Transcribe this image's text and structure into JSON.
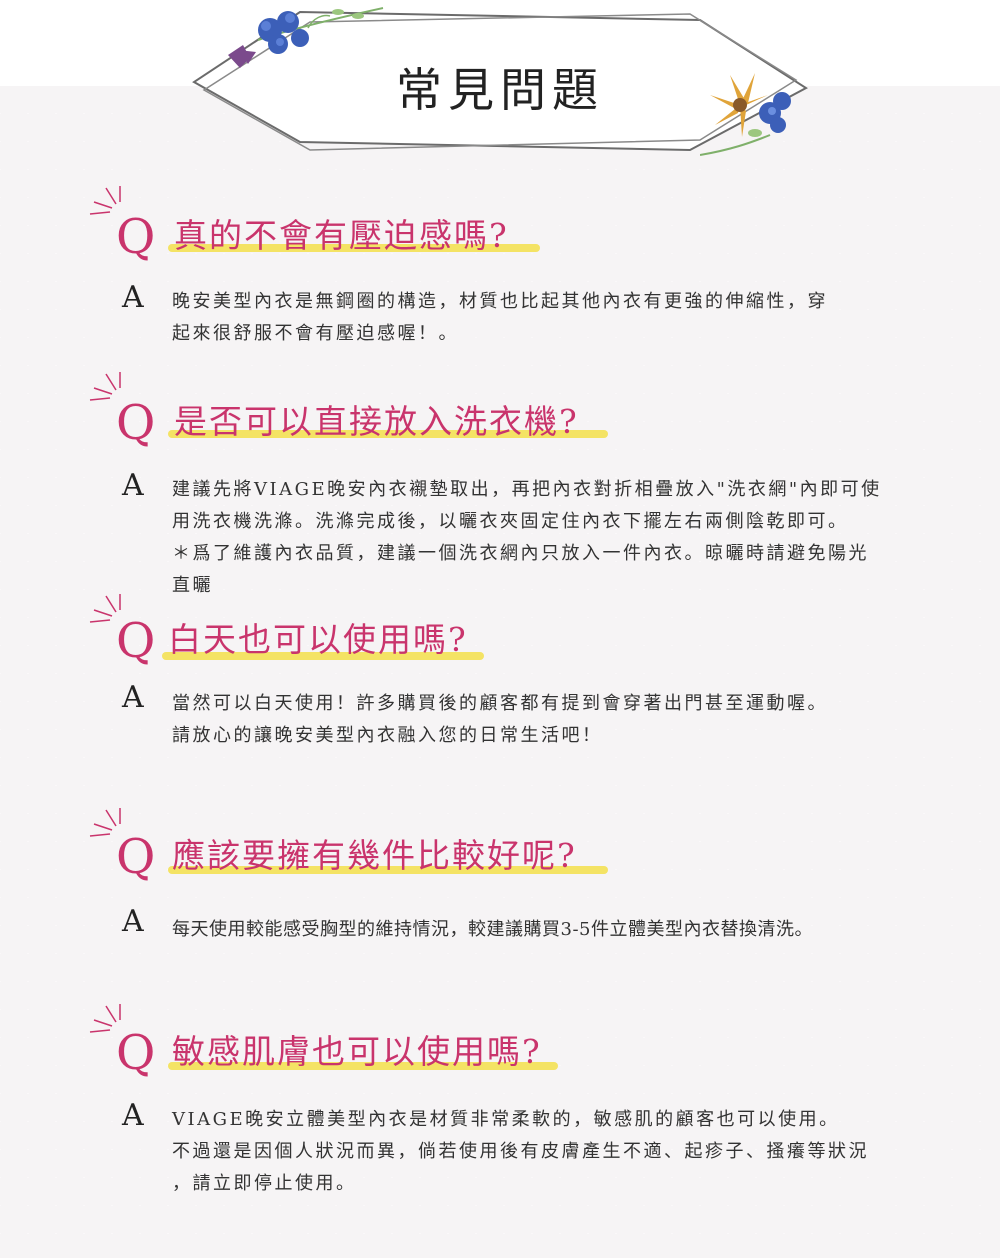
{
  "title": "常見問題",
  "colors": {
    "accent": "#c9346c",
    "highlight": "#f3e25c",
    "background": "#f6f4f5"
  },
  "faqs": [
    {
      "q_letter": "Q",
      "question": "真的不會有壓迫感嗎?",
      "a_letter": "A",
      "answer_lines": [
        "晚安美型內衣是無鋼圈的構造，材質也比起其他內衣有更強的伸縮性，穿",
        "起來很舒服不會有壓迫感喔！。"
      ]
    },
    {
      "q_letter": "Q",
      "question": "是否可以直接放入洗衣機?",
      "a_letter": "A",
      "answer_lines": [
        "建議先將VIAGE晚安內衣襯墊取出，再把內衣對折相疊放入\"洗衣網\"內即可使",
        "用洗衣機洗滌。洗滌完成後，以曬衣夾固定住內衣下擺左右兩側陰乾即可。",
        "＊爲了維護內衣品質，建議一個洗衣網內只放入一件內衣。晾曬時請避免陽光",
        "直曬"
      ]
    },
    {
      "q_letter": "Q",
      "question": "白天也可以使用嗎?",
      "a_letter": "A",
      "answer_lines": [
        "當然可以白天使用！許多購買後的顧客都有提到會穿著出門甚至運動喔。",
        "請放心的讓晚安美型內衣融入您的日常生活吧！"
      ]
    },
    {
      "q_letter": "Q",
      "question": "應該要擁有幾件比較好呢?",
      "a_letter": "A",
      "answer_lines": [
        "每天使用較能感受胸型的維持情況，較建議購買3-5件立體美型內衣替換清洗。"
      ]
    },
    {
      "q_letter": "Q",
      "question": "敏感肌膚也可以使用嗎?",
      "a_letter": "A",
      "answer_lines": [
        "VIAGE晚安立體美型內衣是材質非常柔軟的，敏感肌的顧客也可以使用。",
        "不過還是因個人狀況而異，倘若使用後有皮膚產生不適、起疹子、搔癢等狀況",
        "，請立即停止使用。"
      ]
    }
  ]
}
